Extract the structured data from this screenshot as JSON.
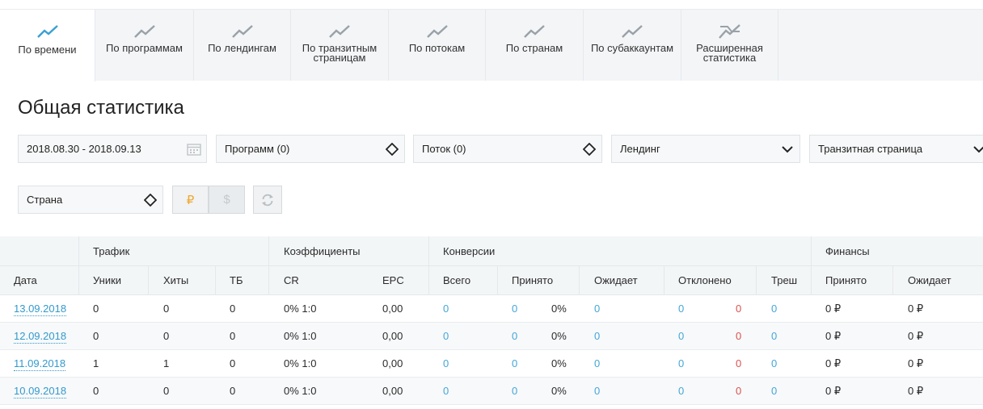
{
  "tabs": [
    {
      "label": "По времени",
      "active": true
    },
    {
      "label": "По программам",
      "active": false
    },
    {
      "label": "По лендингам",
      "active": false
    },
    {
      "label_line1": "По транзитным",
      "label_line2": "страницам",
      "active": false
    },
    {
      "label": "По потокам",
      "active": false
    },
    {
      "label": "По странам",
      "active": false
    },
    {
      "label": "По субаккаунтам",
      "active": false
    },
    {
      "label_line1": "Расширенная",
      "label_line2": "статистика",
      "active": false
    }
  ],
  "page_title": "Общая статистика",
  "filters": {
    "date_range": "2018.08.30 - 2018.09.13",
    "programs": "Программ (0)",
    "stream": "Поток (0)",
    "landing": "Лендинг",
    "transit_page": "Транзитная страница",
    "country": "Страна",
    "currency_rub": "₽",
    "currency_usd": "$"
  },
  "colors": {
    "accent": "#3399cc",
    "active_tab_icon": "#3aa0d2",
    "rub_active": "#f0a830",
    "negative": "#d9534f"
  },
  "table": {
    "groups": {
      "traffic": "Трафик",
      "ratios": "Коэффициенты",
      "conversions": "Конверсии",
      "finance": "Финансы"
    },
    "columns": {
      "date": "Дата",
      "uniques": "Уники",
      "hits": "Хиты",
      "tb": "ТБ",
      "cr": "CR",
      "epc": "EPC",
      "total": "Всего",
      "accepted": "Принято",
      "pending": "Ожидает",
      "rejected": "Отклонено",
      "trash": "Треш",
      "fin_accepted": "Принято",
      "fin_pending": "Ожидает"
    },
    "rows": [
      {
        "date": "13.09.2018",
        "uniques": "0",
        "hits": "0",
        "tb": "0",
        "cr": "0% 1:0",
        "epc": "0,00",
        "total": "0",
        "accepted": "0",
        "accepted_pct": "0%",
        "pending": "0",
        "rejected": "0",
        "rejected_neg": "0",
        "trash": "0",
        "fin_accepted": "0 ₽",
        "fin_pending": "0 ₽"
      },
      {
        "date": "12.09.2018",
        "uniques": "0",
        "hits": "0",
        "tb": "0",
        "cr": "0% 1:0",
        "epc": "0,00",
        "total": "0",
        "accepted": "0",
        "accepted_pct": "0%",
        "pending": "0",
        "rejected": "0",
        "rejected_neg": "0",
        "trash": "0",
        "fin_accepted": "0 ₽",
        "fin_pending": "0 ₽"
      },
      {
        "date": "11.09.2018",
        "uniques": "1",
        "hits": "1",
        "tb": "0",
        "cr": "0% 1:0",
        "epc": "0,00",
        "total": "0",
        "accepted": "0",
        "accepted_pct": "0%",
        "pending": "0",
        "rejected": "0",
        "rejected_neg": "0",
        "trash": "0",
        "fin_accepted": "0 ₽",
        "fin_pending": "0 ₽"
      },
      {
        "date": "10.09.2018",
        "uniques": "0",
        "hits": "0",
        "tb": "0",
        "cr": "0% 1:0",
        "epc": "0,00",
        "total": "0",
        "accepted": "0",
        "accepted_pct": "0%",
        "pending": "0",
        "rejected": "0",
        "rejected_neg": "0",
        "trash": "0",
        "fin_accepted": "0 ₽",
        "fin_pending": "0 ₽"
      }
    ]
  }
}
